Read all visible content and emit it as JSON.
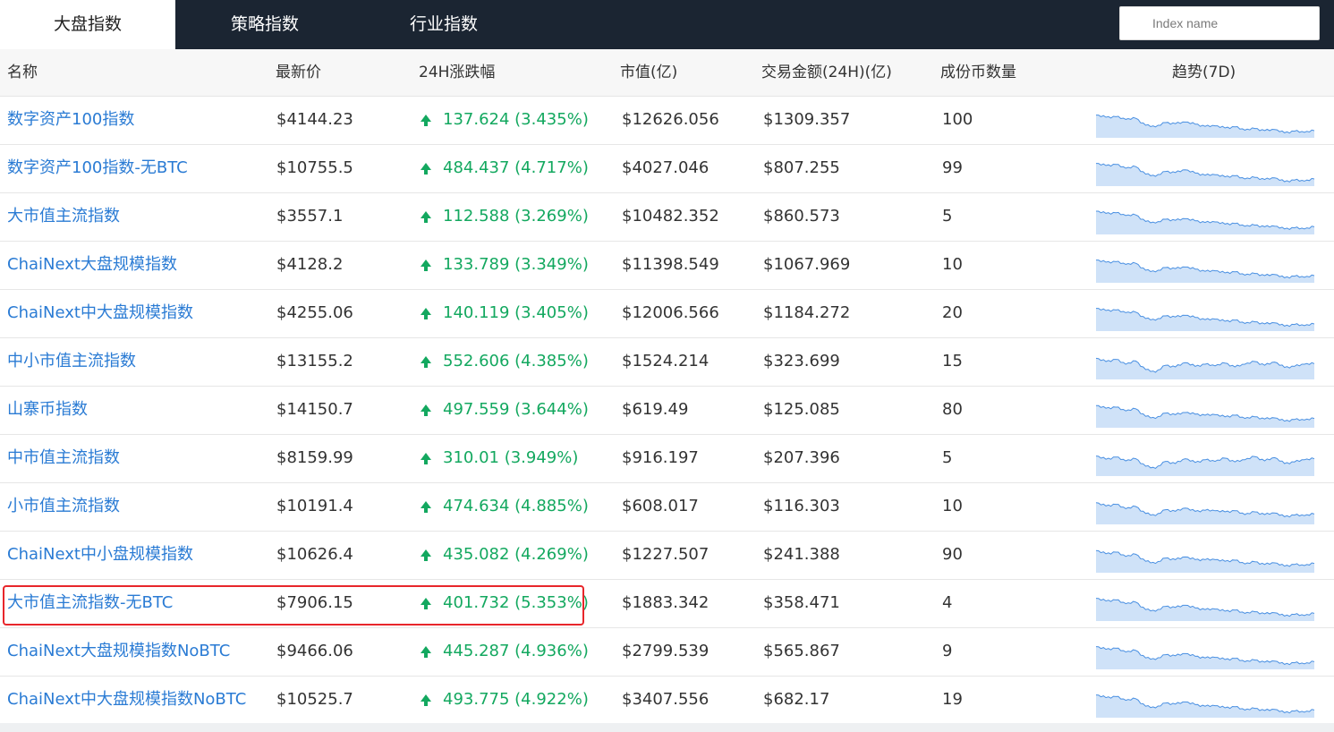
{
  "tabs": [
    {
      "label": "大盘指数",
      "active": true
    },
    {
      "label": "策略指数",
      "active": false
    },
    {
      "label": "行业指数",
      "active": false
    }
  ],
  "search": {
    "placeholder": "Index name",
    "value": ""
  },
  "columns": {
    "name": "名称",
    "price": "最新价",
    "change": "24H涨跌幅",
    "market_cap": "市值(亿)",
    "volume": "交易金额(24H)(亿)",
    "constituents": "成份币数量",
    "trend": "趋势(7D)"
  },
  "colors": {
    "link": "#2a7bd4",
    "up": "#13a85f",
    "spark_line": "#4a90e2",
    "spark_fill": "#cfe2f8",
    "highlight": "#e8262b",
    "nav_bg": "#1b2532"
  },
  "rows": [
    {
      "name": "数字资产100指数",
      "price": "$4144.23",
      "change": "137.624 (3.435%)",
      "market_cap": "$12626.056",
      "volume": "$1309.357",
      "constituents": "100",
      "trend": [
        0.78,
        0.7,
        0.72,
        0.62,
        0.66,
        0.4,
        0.34,
        0.5,
        0.46,
        0.52,
        0.44,
        0.36,
        0.38,
        0.3,
        0.34,
        0.22,
        0.28,
        0.2,
        0.24,
        0.12,
        0.18,
        0.14,
        0.2
      ]
    },
    {
      "name": "数字资产100指数-无BTC",
      "price": "$10755.5",
      "change": "484.437 (4.717%)",
      "market_cap": "$4027.046",
      "volume": "$807.255",
      "constituents": "99",
      "trend": [
        0.78,
        0.7,
        0.74,
        0.6,
        0.66,
        0.38,
        0.3,
        0.48,
        0.44,
        0.54,
        0.42,
        0.34,
        0.36,
        0.28,
        0.32,
        0.2,
        0.26,
        0.18,
        0.24,
        0.1,
        0.16,
        0.12,
        0.2
      ]
    },
    {
      "name": "大市值主流指数",
      "price": "$3557.1",
      "change": "112.588 (3.269%)",
      "market_cap": "$10482.352",
      "volume": "$860.573",
      "constituents": "5",
      "trend": [
        0.8,
        0.72,
        0.74,
        0.64,
        0.66,
        0.42,
        0.36,
        0.5,
        0.46,
        0.52,
        0.44,
        0.38,
        0.4,
        0.32,
        0.34,
        0.24,
        0.28,
        0.22,
        0.24,
        0.14,
        0.18,
        0.14,
        0.22
      ]
    },
    {
      "name": "ChaiNext大盘规模指数",
      "price": "$4128.2",
      "change": "133.789 (3.349%)",
      "market_cap": "$11398.549",
      "volume": "$1067.969",
      "constituents": "10",
      "trend": [
        0.78,
        0.7,
        0.72,
        0.62,
        0.66,
        0.4,
        0.34,
        0.5,
        0.46,
        0.52,
        0.44,
        0.36,
        0.38,
        0.3,
        0.34,
        0.22,
        0.28,
        0.2,
        0.24,
        0.12,
        0.18,
        0.14,
        0.2
      ]
    },
    {
      "name": "ChaiNext中大盘规模指数",
      "price": "$4255.06",
      "change": "140.119 (3.405%)",
      "market_cap": "$12006.566",
      "volume": "$1184.272",
      "constituents": "20",
      "trend": [
        0.78,
        0.7,
        0.72,
        0.62,
        0.64,
        0.4,
        0.34,
        0.5,
        0.46,
        0.52,
        0.44,
        0.36,
        0.38,
        0.3,
        0.34,
        0.22,
        0.28,
        0.2,
        0.24,
        0.12,
        0.18,
        0.14,
        0.2
      ]
    },
    {
      "name": "中小市值主流指数",
      "price": "$13155.2",
      "change": "552.606 (4.385%)",
      "market_cap": "$1524.214",
      "volume": "$323.699",
      "constituents": "15",
      "trend": [
        0.72,
        0.6,
        0.68,
        0.5,
        0.62,
        0.3,
        0.2,
        0.46,
        0.4,
        0.56,
        0.42,
        0.5,
        0.44,
        0.54,
        0.4,
        0.5,
        0.6,
        0.46,
        0.58,
        0.38,
        0.42,
        0.5,
        0.52
      ]
    },
    {
      "name": "山寨币指数",
      "price": "$14150.7",
      "change": "497.559 (3.644%)",
      "market_cap": "$619.49",
      "volume": "$125.085",
      "constituents": "80",
      "trend": [
        0.76,
        0.66,
        0.7,
        0.56,
        0.64,
        0.36,
        0.28,
        0.48,
        0.42,
        0.5,
        0.44,
        0.4,
        0.42,
        0.34,
        0.4,
        0.28,
        0.34,
        0.26,
        0.3,
        0.18,
        0.24,
        0.22,
        0.28
      ]
    },
    {
      "name": "中市值主流指数",
      "price": "$8159.99",
      "change": "310.01 (3.949%)",
      "market_cap": "$916.197",
      "volume": "$207.396",
      "constituents": "5",
      "trend": [
        0.68,
        0.56,
        0.64,
        0.5,
        0.58,
        0.3,
        0.22,
        0.48,
        0.4,
        0.58,
        0.44,
        0.54,
        0.48,
        0.6,
        0.46,
        0.54,
        0.66,
        0.5,
        0.62,
        0.4,
        0.46,
        0.54,
        0.58
      ]
    },
    {
      "name": "小市值主流指数",
      "price": "$10191.4",
      "change": "474.634 (4.885%)",
      "market_cap": "$608.017",
      "volume": "$116.303",
      "constituents": "10",
      "trend": [
        0.74,
        0.62,
        0.68,
        0.52,
        0.6,
        0.34,
        0.26,
        0.48,
        0.42,
        0.54,
        0.42,
        0.46,
        0.44,
        0.4,
        0.44,
        0.3,
        0.4,
        0.3,
        0.36,
        0.22,
        0.28,
        0.26,
        0.32
      ]
    },
    {
      "name": "ChaiNext中小盘规模指数",
      "price": "$10626.4",
      "change": "435.082 (4.269%)",
      "market_cap": "$1227.507",
      "volume": "$241.388",
      "constituents": "90",
      "trend": [
        0.76,
        0.64,
        0.7,
        0.54,
        0.62,
        0.36,
        0.28,
        0.48,
        0.42,
        0.52,
        0.42,
        0.42,
        0.42,
        0.36,
        0.4,
        0.26,
        0.34,
        0.24,
        0.3,
        0.18,
        0.24,
        0.2,
        0.28
      ]
    },
    {
      "name": "大市值主流指数-无BTC",
      "price": "$7906.15",
      "change": "401.732 (5.353%)",
      "market_cap": "$1883.342",
      "volume": "$358.471",
      "constituents": "4",
      "trend": [
        0.78,
        0.68,
        0.72,
        0.58,
        0.64,
        0.36,
        0.3,
        0.48,
        0.44,
        0.52,
        0.42,
        0.36,
        0.38,
        0.3,
        0.34,
        0.22,
        0.28,
        0.2,
        0.24,
        0.12,
        0.18,
        0.14,
        0.22
      ]
    },
    {
      "name": "ChaiNext大盘规模指数NoBTC",
      "price": "$9466.06",
      "change": "445.287 (4.936%)",
      "market_cap": "$2799.539",
      "volume": "$565.867",
      "constituents": "9",
      "trend": [
        0.78,
        0.68,
        0.72,
        0.58,
        0.64,
        0.36,
        0.3,
        0.48,
        0.44,
        0.52,
        0.42,
        0.36,
        0.38,
        0.3,
        0.34,
        0.22,
        0.28,
        0.2,
        0.24,
        0.12,
        0.18,
        0.14,
        0.22
      ]
    },
    {
      "name": "ChaiNext中大盘规模指数NoBTC",
      "price": "$10525.7",
      "change": "493.775 (4.922%)",
      "market_cap": "$3407.556",
      "volume": "$682.17",
      "constituents": "19",
      "trend": [
        0.78,
        0.68,
        0.72,
        0.58,
        0.64,
        0.36,
        0.3,
        0.48,
        0.44,
        0.52,
        0.42,
        0.36,
        0.38,
        0.3,
        0.34,
        0.22,
        0.28,
        0.2,
        0.24,
        0.12,
        0.18,
        0.14,
        0.22
      ]
    }
  ]
}
